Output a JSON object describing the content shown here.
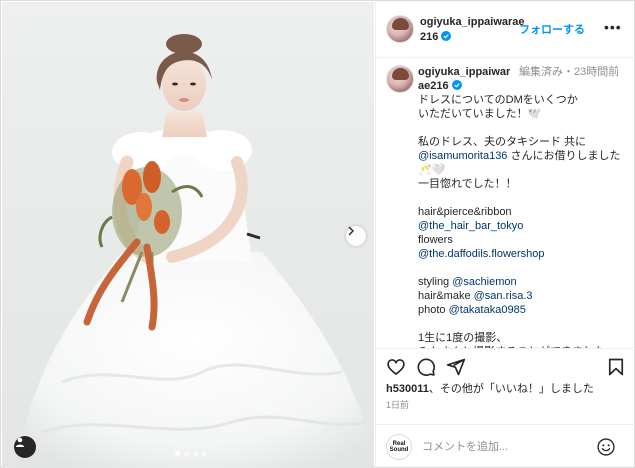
{
  "post": {
    "slides": {
      "count": 4,
      "active": 0
    }
  },
  "header": {
    "username": "ogiyuka_ippaiwarae216",
    "follow_label": "フォローする",
    "separator": "•",
    "more_label": "•••"
  },
  "caption": {
    "username": "ogiyuka_ippaiwarae216",
    "meta": "編集済み・23時間前",
    "lines": [
      {
        "text": "ドレスについてのDMをいくつか"
      },
      {
        "text": "いただいていました！🕊️"
      },
      {
        "text": ""
      },
      {
        "text": "私のドレス、夫のタキシード 共に"
      },
      {
        "mention": "@isamumorita136",
        "text": " さんにお借りしました"
      },
      {
        "text": "🥂🤍"
      },
      {
        "text": "一目惚れでした！！"
      },
      {
        "text": ""
      },
      {
        "text": "hair&pierce&ribbon"
      },
      {
        "mention": "@the_hair_bar_tokyo"
      },
      {
        "text": "flowers"
      },
      {
        "mention": "@the.daffodils.flowershop"
      },
      {
        "text": ""
      },
      {
        "text": "styling ",
        "mention": "@sachiemon"
      },
      {
        "text": "hair&make ",
        "mention": "@san.risa.3"
      },
      {
        "text": "photo ",
        "mention": "@takataka0985"
      },
      {
        "text": ""
      },
      {
        "text": "1生に1度の撮影、"
      },
      {
        "text": "みなさんと撮影することができました"
      }
    ]
  },
  "actions": {
    "likes_user": "h530011",
    "likes_text": "、その他が「いいね！」しました",
    "time": "1日前"
  },
  "composer": {
    "avatar_line1": "Real",
    "avatar_line2": "Sound",
    "placeholder": "コメントを追加..."
  },
  "colors": {
    "accent": "#0095f6",
    "mention": "#00376b",
    "muted": "#8e8e8e",
    "dress_ribbon": "#c8643a"
  },
  "icons": [
    "heart-icon",
    "comment-icon",
    "share-icon",
    "bookmark-icon",
    "emoji-icon",
    "verified-icon",
    "chevron-right-icon",
    "user-tag-icon"
  ]
}
